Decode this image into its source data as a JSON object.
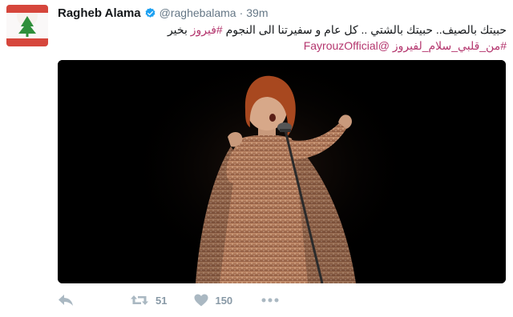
{
  "tweet": {
    "author_name": "Ragheb Alama",
    "handle": "@raghebalama",
    "separator": "·",
    "time": "39m",
    "text_line1_part1": "حبيتك بالصيف.. حبيتك بالشتي .. كل عام و سفيرتنا الى النجوم ",
    "text_line1_hashtag": "#فيروز",
    "text_line1_part2": " بخير",
    "text_line2_hashtag": "#من_قلبي_سلام_لفيروز",
    "text_line2_mention": "@FayrouzOfficial"
  },
  "actions": {
    "reply_icon": "reply-icon",
    "retweet_icon": "retweet-icon",
    "retweet_count": "51",
    "like_icon": "heart-icon",
    "like_count": "150",
    "more_icon": "more-dots-icon"
  },
  "colors": {
    "hashtag": "#b4366e",
    "muted": "#657786",
    "icon": "#aab8c2",
    "verified": "#1da1f2",
    "media_bg": "#000000",
    "dress": "#b3795c"
  }
}
